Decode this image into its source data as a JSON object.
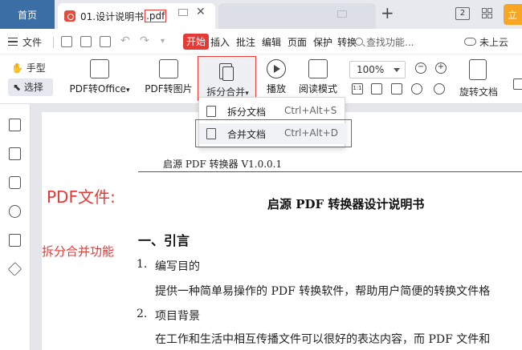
{
  "tabbar": {
    "home_label": "首页",
    "doc_tab_title": "01.设计说明书",
    "doc_tab_ext": ".pdf",
    "new_tab_symbol": "+",
    "window_count": "2",
    "user_avatar_text": "立"
  },
  "menubar": {
    "file_label": "文件",
    "items": [
      "开始",
      "插入",
      "批注",
      "编辑",
      "页面",
      "保护",
      "转换"
    ],
    "search_placeholder": "查找功能...",
    "cloud_label": "未上云"
  },
  "ribbon": {
    "hand_label": "手型",
    "select_label": "选择",
    "pdf_to_office": "PDF转Office",
    "pdf_to_image": "PDF转图片",
    "split_merge": "拆分合并",
    "play": "播放",
    "reading_mode": "阅读模式",
    "zoom_value": "100%",
    "rotate_doc": "旋转文档"
  },
  "dropdown": {
    "items": [
      {
        "label": "拆分文档",
        "shortcut": "Ctrl+Alt+S"
      },
      {
        "label": "合并文档",
        "shortcut": "Ctrl+Alt+D"
      }
    ]
  },
  "annotations": {
    "pdf_file": "PDF文件:",
    "split_merge_feature": "拆分合并功能"
  },
  "document": {
    "header": "启源 PDF 转换器 V1.0.0.1",
    "title": "启源 PDF 转换器设计说明书",
    "section1": "一、引言",
    "item1_num": "1.",
    "item1": "编写目的",
    "item1_body": "提供一种简单易操作的 PDF 转换软件，帮助用户简便的转换文件格",
    "item2_num": "2.",
    "item2": "项目背景",
    "item2_body": "在工作和生活中相互传播文件可以很好的表达内容，而 PDF 文件和"
  },
  "colors": {
    "accent_red": "#e53935",
    "home_tab_blue": "#3a6ea5",
    "avatar_orange": "#f6a623"
  }
}
